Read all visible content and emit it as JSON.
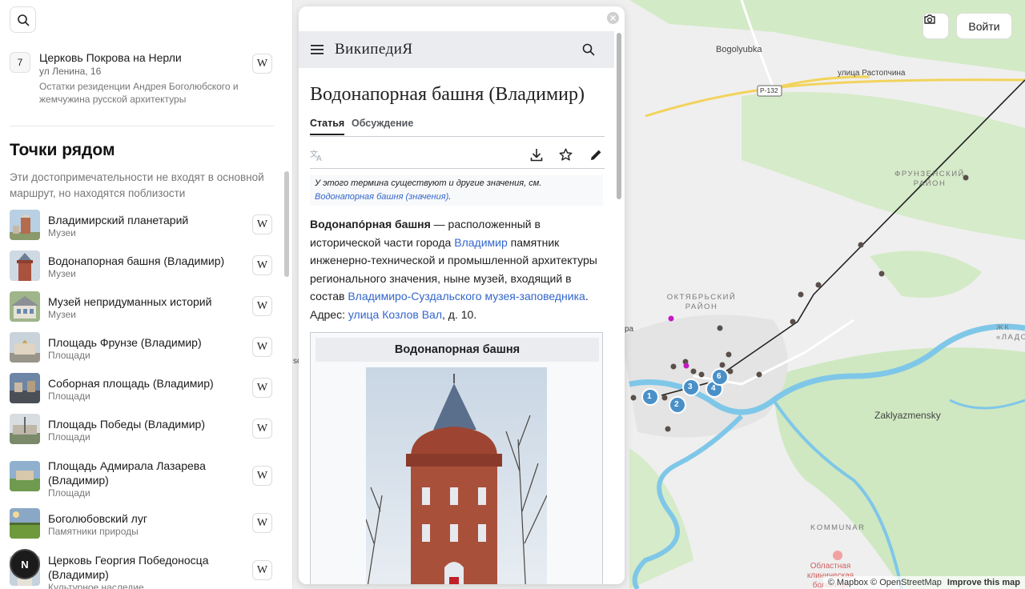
{
  "top_item": {
    "number": "7",
    "title": "Церковь Покрова на Нерли",
    "address": "ул Ленина, 16",
    "description": "Остатки резиденции Андрея Боголюбского и жемчужина русской архитектуры",
    "wiki_label": "W"
  },
  "nearby": {
    "title": "Точки рядом",
    "description": "Эти достопримечательности не входят в основной маршрут, но находятся поблизости",
    "items": [
      {
        "name": "Владимирский планетарий",
        "category": "Музеи"
      },
      {
        "name": "Водонапорная башня (Владимир)",
        "category": "Музеи"
      },
      {
        "name": "Музей непридуманных историй",
        "category": "Музеи"
      },
      {
        "name": "Площадь Фрунзе (Владимир)",
        "category": "Площади"
      },
      {
        "name": "Соборная площадь (Владимир)",
        "category": "Площади"
      },
      {
        "name": "Площадь Победы (Владимир)",
        "category": "Площади"
      },
      {
        "name": "Площадь Адмирала Лазарева (Владимир)",
        "category": "Площади"
      },
      {
        "name": "Боголюбовский луг",
        "category": "Памятники природы"
      },
      {
        "name": "Церковь Георгия Победоносца (Владимир)",
        "category": "Культурное наследие"
      }
    ]
  },
  "avatar_letter": "N",
  "wiki": {
    "logo": "ВикипедиЯ",
    "title": "Водонапорная башня (Владимир)",
    "tab_article": "Статья",
    "tab_discussion": "Обсуждение",
    "hatnote_line1": "У этого термина существуют и другие значения, см.",
    "hatnote_link": "Водонапорная башня (значения)",
    "hatnote_end": ".",
    "text_bold": "Водонапо́рная башня",
    "text_1": " — расположенный в исторической части города ",
    "link_1": "Владимир",
    "text_2": " памятник инженерно-технической и промышленной архитектуры регионального значения, ныне музей, входящий в состав ",
    "link_2": "Владимиро-Суздальского музея-заповедника",
    "text_3": ". Адрес: ",
    "link_3": "улица Козлов Вал",
    "text_4": ", д. 10.",
    "infobox_title": "Водонапорная башня"
  },
  "map": {
    "labels": {
      "bogolyubka": "Bogolyubka",
      "street": "улица Растопчина",
      "road": "Р-132",
      "frunzensky": "ФРУНЗЕНСКИЙ РАЙОН",
      "oktyabrsky": "ОКТЯБРЬСКИЙ РАЙОН",
      "zaklyazmensky": "Zaklyazmensky",
      "kommunar": "KOMMUNAR",
      "ladoga": "ЖК «ЛАДОГА»",
      "hospital": "Областная клиническая больница",
      "ra": "ра",
      "sc": "sc"
    },
    "clusters": [
      "1",
      "2",
      "3",
      "4",
      "6"
    ],
    "login": "Войти",
    "attribution_left": "© Mapbox © OpenStreetMap",
    "attribution_right": "Improve this map"
  },
  "colors": {
    "accent": "#3366cc",
    "cluster": "#4a90c8",
    "river": "#7fc7e8",
    "park": "#cfe8c1"
  }
}
